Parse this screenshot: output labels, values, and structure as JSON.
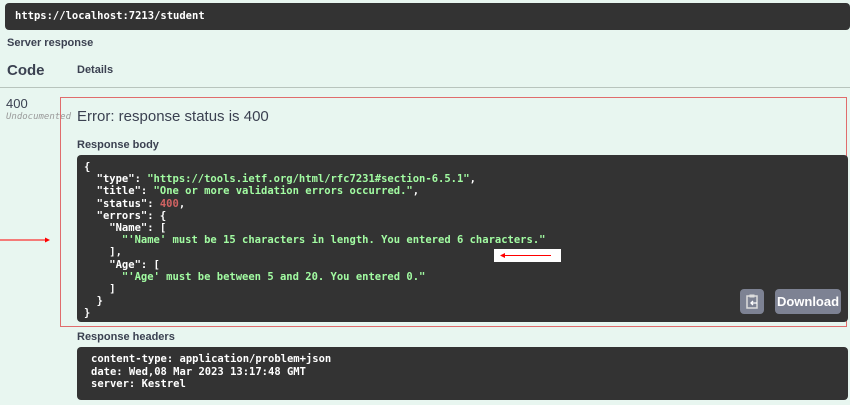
{
  "request_url": "https://localhost:7213/student",
  "server_response_label": "Server response",
  "columns": {
    "code": "Code",
    "details": "Details"
  },
  "response": {
    "code": "400",
    "code_note": "Undocumented",
    "error_title": "Error: response status is 400",
    "body_label": "Response body",
    "body_lines": [
      [
        [
          "k",
          "{"
        ]
      ],
      [
        [
          "k",
          "  \"type\": "
        ],
        [
          "s",
          "\"https://tools.ietf.org/html/rfc7231#section-6.5.1\""
        ],
        [
          "k",
          ","
        ]
      ],
      [
        [
          "k",
          "  \"title\": "
        ],
        [
          "s",
          "\"One or more validation errors occurred.\""
        ],
        [
          "k",
          ","
        ]
      ],
      [
        [
          "k",
          "  \"status\": "
        ],
        [
          "n",
          "400"
        ],
        [
          "k",
          ","
        ]
      ],
      [
        [
          "k",
          "  \"errors\": {"
        ]
      ],
      [
        [
          "k",
          "    \"Name\": ["
        ]
      ],
      [
        [
          "s",
          "      \"'Name' must be 15 characters in length. You entered 6 characters.\""
        ]
      ],
      [
        [
          "k",
          "    ],"
        ]
      ],
      [
        [
          "k",
          "    \"Age\": ["
        ]
      ],
      [
        [
          "s",
          "      \"'Age' must be between 5 and 20. You entered 0.\""
        ]
      ],
      [
        [
          "k",
          "    ]"
        ]
      ],
      [
        [
          "k",
          "  }"
        ]
      ],
      [
        [
          "k",
          "}"
        ]
      ]
    ],
    "download_label": "Download",
    "headers_label": "Response headers",
    "headers": [
      "content-type: application/problem+json",
      "date: Wed,08 Mar 2023 13:17:48 GMT",
      "server: Kestrel"
    ]
  }
}
